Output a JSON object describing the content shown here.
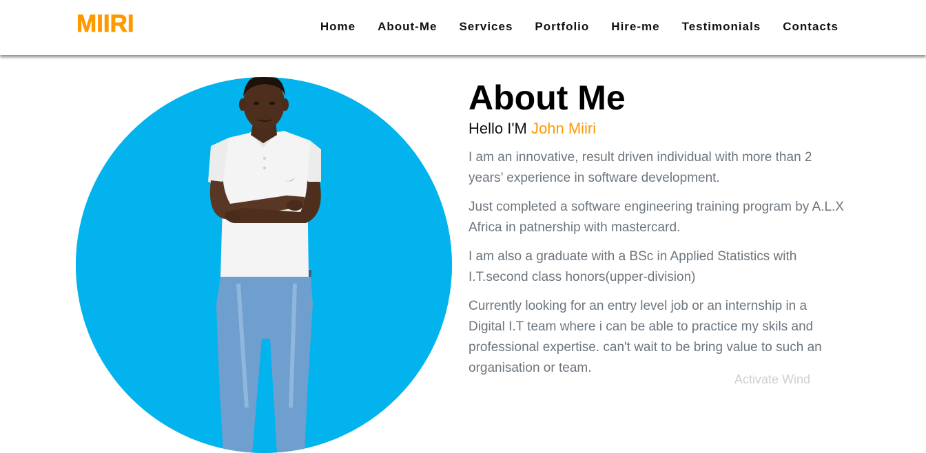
{
  "brand": {
    "logo": "MIIRI",
    "accent_color": "#ff9900"
  },
  "nav": {
    "items": [
      {
        "label": "Home"
      },
      {
        "label": "About-Me"
      },
      {
        "label": "Services"
      },
      {
        "label": "Portfolio"
      },
      {
        "label": "Hire-me"
      },
      {
        "label": "Testimonials"
      },
      {
        "label": "Contacts"
      }
    ]
  },
  "about": {
    "title": "About Me",
    "hello_prefix": "Hello I'M ",
    "name": "John Miiri",
    "paragraphs": [
      "I am an innovative, result driven individual with more than 2 years’ experience in software development.",
      "Just completed a software engineering training program by A.L.X Africa in patnership with mastercard.",
      "I am also a graduate with a BSc in Applied Statistics with I.T.second class honors(upper-division)",
      "Currently looking for an entry level job or an internship in a Digital I.T team where i can be able to practice my skils and professional expertise. can't wait to be bring value to such an organisation or team."
    ]
  },
  "overlay": {
    "watermark": "Activate Wind"
  },
  "colors": {
    "photo_background": "#03b3ee",
    "paragraph_text": "#6c757d"
  }
}
